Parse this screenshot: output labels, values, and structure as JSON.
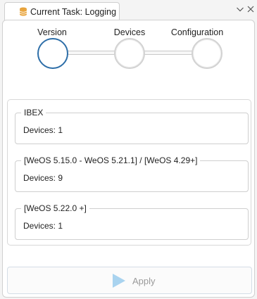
{
  "tab": {
    "title": "Current Task: Logging",
    "icon": "database-icon",
    "accent": "#e8a33a"
  },
  "window_controls": {
    "expand_icon": "chevron-down-icon",
    "close_icon": "close-icon"
  },
  "steps": [
    {
      "label": "Version",
      "state": "active"
    },
    {
      "label": "Devices",
      "state": "inactive"
    },
    {
      "label": "Configuration",
      "state": "inactive"
    }
  ],
  "groups": [
    {
      "title": "IBEX",
      "devices": "Devices: 1"
    },
    {
      "title": "[WeOS 5.15.0 - WeOS 5.21.1] / [WeOS 4.29+]",
      "devices": "Devices: 9"
    },
    {
      "title": "[WeOS 5.22.0 +]",
      "devices": "Devices: 1"
    }
  ],
  "apply": {
    "label": "Apply",
    "icon": "play-icon",
    "enabled": false
  },
  "colors": {
    "active_step": "#2d6ea8",
    "inactive_step": "#d2d2d2",
    "apply_icon": "#a9d3ef"
  }
}
